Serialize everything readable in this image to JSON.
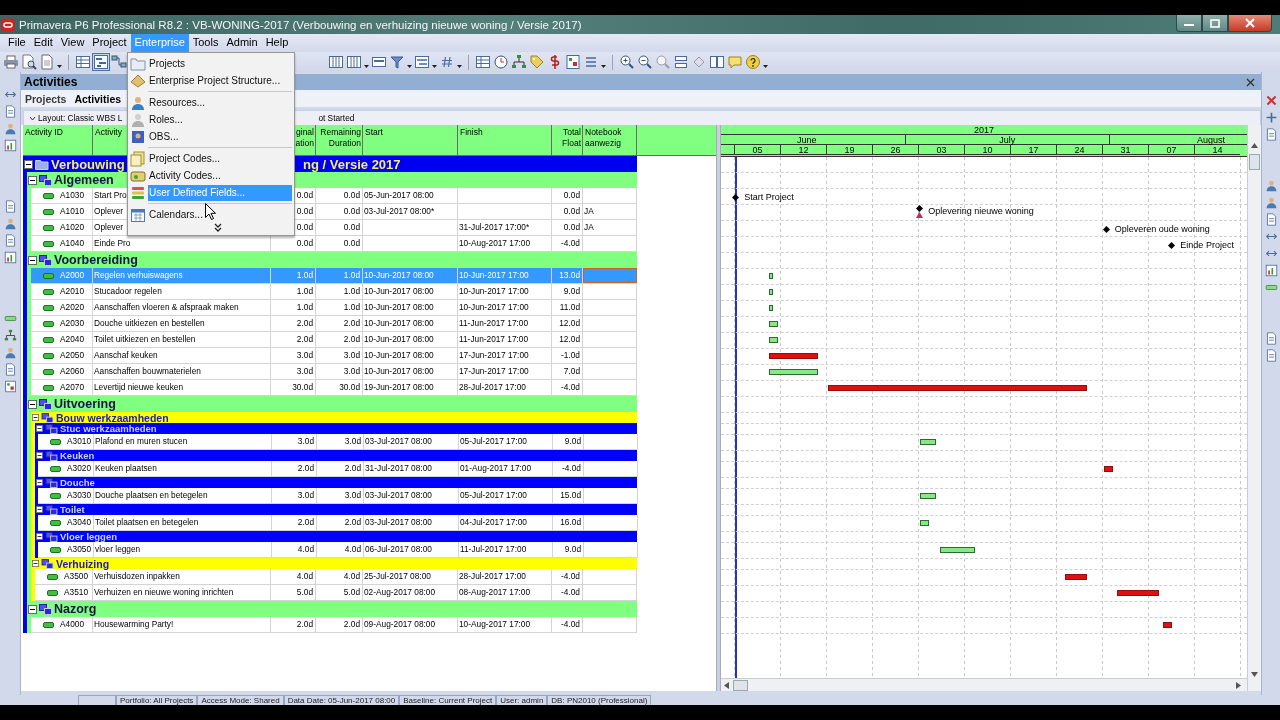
{
  "window": {
    "title": "Primavera P6 Professional R8.2 : VB-WONING-2017 (Verbouwing en verhuizing nieuwe woning / Versie 2017)"
  },
  "menu_bar": [
    {
      "label": "File",
      "selected": false
    },
    {
      "label": "Edit",
      "selected": false
    },
    {
      "label": "View",
      "selected": false
    },
    {
      "label": "Project",
      "selected": false
    },
    {
      "label": "Enterprise",
      "selected": true
    },
    {
      "label": "Tools",
      "selected": false
    },
    {
      "label": "Admin",
      "selected": false
    },
    {
      "label": "Help",
      "selected": false
    }
  ],
  "enterprise_menu": [
    {
      "kind": "item",
      "label": "Projects",
      "selected": false
    },
    {
      "kind": "item",
      "label": "Enterprise Project Structure...",
      "selected": false
    },
    {
      "kind": "separator"
    },
    {
      "kind": "item",
      "label": "Resources...",
      "selected": false
    },
    {
      "kind": "item",
      "label": "Roles...",
      "selected": false
    },
    {
      "kind": "item",
      "label": "OBS...",
      "selected": false
    },
    {
      "kind": "separator"
    },
    {
      "kind": "item",
      "label": "Project Codes...",
      "selected": false
    },
    {
      "kind": "item",
      "label": "Activity Codes...",
      "selected": false
    },
    {
      "kind": "item",
      "label": "User Defined Fields...",
      "selected": true
    },
    {
      "kind": "separator"
    },
    {
      "kind": "item",
      "label": "Calendars...",
      "selected": false
    },
    {
      "kind": "more"
    }
  ],
  "panel": {
    "title": "Activities",
    "tabs": [
      {
        "label": "Projects",
        "selected": false
      },
      {
        "label": "Activities",
        "selected": true
      }
    ],
    "layout_left": "Layout: Classic WBS L",
    "layout_right": "ot Started"
  },
  "table": {
    "columns": [
      "Activity ID",
      "Activity",
      "ginal\nation",
      "Remaining\nDuration",
      "Start",
      "Finish",
      "Total\nFloat",
      "Notebook\naanwezig"
    ],
    "wbs": {
      "label": "Verbouwing",
      "label_tail": "ng / Versie 2017",
      "expanded": true,
      "children": [
        {
          "kind": "wbs",
          "label": "Algemeen",
          "expanded": true,
          "children": [
            {
              "kind": "milestone",
              "id": "A1030",
              "name": "Start Pro",
              "original_duration": "0.0d",
              "remaining_duration": "0.0d",
              "start": "05-Jun-2017 08:00",
              "total_float": "0.0d",
              "bar_label": "Start Project",
              "selected": false,
              "constraint": false
            },
            {
              "kind": "milestone",
              "id": "A1010",
              "name": "Oplever",
              "original_duration": "0.0d",
              "remaining_duration": "0.0d",
              "start": "03-Jul-2017 08:00*",
              "total_float": "0.0d",
              "notebook": "JA",
              "bar_label": "Oplevering nieuwe woning",
              "selected": false,
              "constraint": true
            },
            {
              "kind": "milestone",
              "id": "A1020",
              "name": "Oplever",
              "original_duration": "0.0d",
              "remaining_duration": "0.0d",
              "finish": "31-Jul-2017 17:00*",
              "total_float": "0.0d",
              "notebook": "JA",
              "bar_label": "Opleveren oude woning",
              "selected": false,
              "constraint": false
            },
            {
              "kind": "milestone",
              "id": "A1040",
              "name": "Einde Pro",
              "original_duration": "0.0d",
              "remaining_duration": "0.0d",
              "finish": "10-Aug-2017 17:00",
              "total_float": "-4.0d",
              "bar_label": "Einde Project",
              "selected": false,
              "constraint": false
            }
          ]
        },
        {
          "kind": "wbs",
          "label": "Voorbereiding",
          "expanded": true,
          "children": [
            {
              "kind": "task",
              "id": "A2000",
              "name": "Regelen verhuiswagens",
              "original_duration": "1.0d",
              "remaining_duration": "1.0d",
              "start": "10-Jun-2017 08:00",
              "finish": "10-Jun-2017 17:00",
              "total_float": "13.0d",
              "selected": true,
              "critical": false,
              "constraint": false
            },
            {
              "kind": "task",
              "id": "A2010",
              "name": "Stucadoor regelen",
              "original_duration": "1.0d",
              "remaining_duration": "1.0d",
              "start": "10-Jun-2017 08:00",
              "finish": "10-Jun-2017 17:00",
              "total_float": "9.0d",
              "selected": false,
              "critical": false,
              "constraint": false
            },
            {
              "kind": "task",
              "id": "A2020",
              "name": "Aanschaffen vloeren & afspraak maken",
              "original_duration": "1.0d",
              "remaining_duration": "1.0d",
              "start": "10-Jun-2017 08:00",
              "finish": "10-Jun-2017 17:00",
              "total_float": "11.0d",
              "selected": false,
              "critical": false,
              "constraint": false
            },
            {
              "kind": "task",
              "id": "A2030",
              "name": "Douche uitkiezen en bestellen",
              "original_duration": "2.0d",
              "remaining_duration": "2.0d",
              "start": "10-Jun-2017 08:00",
              "finish": "11-Jun-2017 17:00",
              "total_float": "12.0d",
              "selected": false,
              "critical": false,
              "constraint": false
            },
            {
              "kind": "task",
              "id": "A2040",
              "name": "Toilet uitkiezen en bestellen",
              "original_duration": "2.0d",
              "remaining_duration": "2.0d",
              "start": "10-Jun-2017 08:00",
              "finish": "11-Jun-2017 17:00",
              "total_float": "12.0d",
              "selected": false,
              "critical": false,
              "constraint": false
            },
            {
              "kind": "task",
              "id": "A2050",
              "name": "Aanschaf keuken",
              "original_duration": "3.0d",
              "remaining_duration": "3.0d",
              "start": "10-Jun-2017 08:00",
              "finish": "17-Jun-2017 17:00",
              "total_float": "-1.0d",
              "selected": false,
              "critical": true,
              "constraint": false
            },
            {
              "kind": "task",
              "id": "A2060",
              "name": "Aanschaffen bouwmaterielen",
              "original_duration": "3.0d",
              "remaining_duration": "3.0d",
              "start": "10-Jun-2017 08:00",
              "finish": "17-Jun-2017 17:00",
              "total_float": "7.0d",
              "selected": false,
              "critical": false,
              "constraint": false
            },
            {
              "kind": "task",
              "id": "A2070",
              "name": "Levertijd nieuwe keuken",
              "original_duration": "30.0d",
              "remaining_duration": "30.0d",
              "start": "19-Jun-2017 08:00",
              "finish": "28-Jul-2017 17:00",
              "total_float": "-4.0d",
              "selected": false,
              "critical": true,
              "constraint": false
            }
          ]
        },
        {
          "kind": "wbs",
          "label": "Uitvoering",
          "expanded": true,
          "children": [
            {
              "kind": "wbs",
              "label": "Bouw werkzaamheden",
              "expanded": true,
              "children": [
                {
                  "kind": "wbs",
                  "label": "Stuc werkzaamheden",
                  "expanded": true,
                  "children": [
                    {
                      "kind": "task",
                      "id": "A3010",
                      "name": "Plafond en muren stucen",
                      "original_duration": "3.0d",
                      "remaining_duration": "3.0d",
                      "start": "03-Jul-2017 08:00",
                      "finish": "05-Jul-2017 17:00",
                      "total_float": "9.0d",
                      "selected": false,
                      "critical": false,
                      "constraint": false
                    }
                  ]
                },
                {
                  "kind": "wbs",
                  "label": "Keuken",
                  "expanded": true,
                  "children": [
                    {
                      "kind": "task",
                      "id": "A3020",
                      "name": "Keuken plaatsen",
                      "original_duration": "2.0d",
                      "remaining_duration": "2.0d",
                      "start": "31-Jul-2017 08:00",
                      "finish": "01-Aug-2017 17:00",
                      "total_float": "-4.0d",
                      "selected": false,
                      "critical": true,
                      "constraint": false
                    }
                  ]
                },
                {
                  "kind": "wbs",
                  "label": "Douche",
                  "expanded": true,
                  "children": [
                    {
                      "kind": "task",
                      "id": "A3030",
                      "name": "Douche plaatsen en betegelen",
                      "original_duration": "3.0d",
                      "remaining_duration": "3.0d",
                      "start": "03-Jul-2017 08:00",
                      "finish": "05-Jul-2017 17:00",
                      "total_float": "15.0d",
                      "selected": false,
                      "critical": false,
                      "constraint": false
                    }
                  ]
                },
                {
                  "kind": "wbs",
                  "label": "Toilet",
                  "expanded": true,
                  "children": [
                    {
                      "kind": "task",
                      "id": "A3040",
                      "name": "Toilet plaatsen en betegelen",
                      "original_duration": "2.0d",
                      "remaining_duration": "2.0d",
                      "start": "03-Jul-2017 08:00",
                      "finish": "04-Jul-2017 17:00",
                      "total_float": "16.0d",
                      "selected": false,
                      "critical": false,
                      "constraint": false
                    }
                  ]
                },
                {
                  "kind": "wbs",
                  "label": "Vloer leggen",
                  "expanded": true,
                  "children": [
                    {
                      "kind": "task",
                      "id": "A3050",
                      "name": "vloer leggen",
                      "original_duration": "4.0d",
                      "remaining_duration": "4.0d",
                      "start": "06-Jul-2017 08:00",
                      "finish": "11-Jul-2017 17:00",
                      "total_float": "9.0d",
                      "selected": false,
                      "critical": false,
                      "constraint": false
                    }
                  ]
                }
              ]
            },
            {
              "kind": "wbs",
              "label": "Verhuizing",
              "expanded": true,
              "children": [
                {
                  "kind": "task",
                  "id": "A3500",
                  "name": "Verhuisdozen inpakken",
                  "original_duration": "4.0d",
                  "remaining_duration": "4.0d",
                  "start": "25-Jul-2017 08:00",
                  "finish": "28-Jul-2017 17:00",
                  "total_float": "-4.0d",
                  "selected": false,
                  "critical": true,
                  "constraint": false
                },
                {
                  "kind": "task",
                  "id": "A3510",
                  "name": "Verhuizen en nieuwe woning inrichten",
                  "original_duration": "5.0d",
                  "remaining_duration": "5.0d",
                  "start": "02-Aug-2017 08:00",
                  "finish": "08-Aug-2017 17:00",
                  "total_float": "-4.0d",
                  "selected": false,
                  "critical": true,
                  "constraint": false
                }
              ]
            }
          ]
        },
        {
          "kind": "wbs",
          "label": "Nazorg",
          "expanded": true,
          "children": [
            {
              "kind": "task",
              "id": "A4000",
              "name": "Housewarming Party!",
              "original_duration": "2.0d",
              "remaining_duration": "2.0d",
              "start": "09-Aug-2017 08:00",
              "finish": "10-Aug-2017 17:00",
              "total_float": "-4.0d",
              "selected": false,
              "critical": true,
              "constraint": false
            }
          ]
        }
      ]
    }
  },
  "gantt": {
    "year": "2017",
    "months": [
      "June",
      "July",
      "August"
    ],
    "weeks": [
      "05",
      "12",
      "19",
      "26",
      "03",
      "10",
      "17",
      "24",
      "31",
      "07",
      "14"
    ]
  },
  "status_bar": [
    "Portfolio: All Projects",
    "Access Mode: Shared",
    "Data Date: 05-Jun-2017 08:00",
    "Baseline: Current Project",
    "User: admin",
    "DB: PN2010 (Professional)"
  ]
}
